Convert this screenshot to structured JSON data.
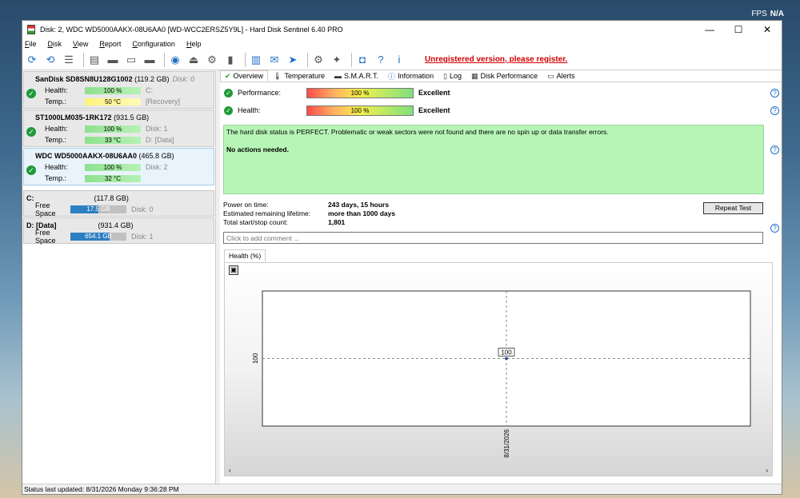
{
  "desktop": {
    "fps_label": "FPS",
    "fps_value": "N/A"
  },
  "window": {
    "title": "Disk: 2, WDC WD5000AAKX-08U6AA0 [WD-WCC2ERSZ5Y9L]  -  Hard Disk Sentinel 6.40 PRO",
    "controls": {
      "minimize": "—",
      "maximize": "☐",
      "close": "✕"
    }
  },
  "menu": [
    "File",
    "Disk",
    "View",
    "Report",
    "Configuration",
    "Help"
  ],
  "toolbar": {
    "register_text": "Unregistered version, please register."
  },
  "disks": [
    {
      "name": "SanDisk SD8SN8U128G1002",
      "size": "(119.2 GB)",
      "disk_num": "Disk: 0",
      "health_label": "Health:",
      "health": "100 %",
      "health_aux": "C:",
      "temp_label": "Temp.:",
      "temp": "50 °C",
      "temp_aux": "[Recovery]"
    },
    {
      "name": "ST1000LM035-1RK172",
      "size": "(931.5 GB)",
      "disk_num": "",
      "health_label": "Health:",
      "health": "100 %",
      "health_aux": "Disk: 1",
      "temp_label": "Temp.:",
      "temp": "33 °C",
      "temp_aux": "D: [Data]"
    },
    {
      "name": "WDC WD5000AAKX-08U6AA0",
      "size": "(465.8 GB)",
      "disk_num": "",
      "health_label": "Health:",
      "health": "100 %",
      "health_aux": "Disk: 2",
      "temp_label": "Temp.:",
      "temp": "32 °C",
      "temp_aux": ""
    }
  ],
  "volumes": [
    {
      "name": "C:",
      "size": "(117.8 GB)",
      "free_label": "Free Space",
      "free": "17.5 GB",
      "disk": "Disk: 0"
    },
    {
      "name": "D: [Data]",
      "size": "(931.4 GB)",
      "free_label": "Free Space",
      "free": "654.1 GB",
      "disk": "Disk: 1"
    }
  ],
  "tabs": [
    "Overview",
    "Temperature",
    "S.M.A.R.T.",
    "Information",
    "Log",
    "Disk Performance",
    "Alerts"
  ],
  "overview": {
    "performance_label": "Performance:",
    "performance_value": "100 %",
    "performance_rating": "Excellent",
    "health_label": "Health:",
    "health_value": "100 %",
    "health_rating": "Excellent",
    "status_text": "The hard disk status is PERFECT. Problematic or weak sectors were not found and there are no spin up or data transfer errors.",
    "actions_text": "No actions needed.",
    "power_on_label": "Power on time:",
    "power_on_value": "243 days, 15 hours",
    "lifetime_label": "Estimated remaining lifetime:",
    "lifetime_value": "more than 1000 days",
    "startstop_label": "Total start/stop count:",
    "startstop_value": "1,801",
    "repeat_button": "Repeat Test",
    "comment_placeholder": "Click to add comment ..."
  },
  "chart_tab": "Health (%)",
  "chart_data": {
    "type": "line",
    "x": [
      "8/31/2026"
    ],
    "series": [
      {
        "values": [
          100
        ]
      }
    ],
    "title": "",
    "xlabel": "",
    "ylabel": "",
    "y_tick_label": "100",
    "data_label": "100"
  },
  "statusbar": {
    "text": "Status last updated: 8/31/2026 Monday 9:36:28 PM"
  }
}
